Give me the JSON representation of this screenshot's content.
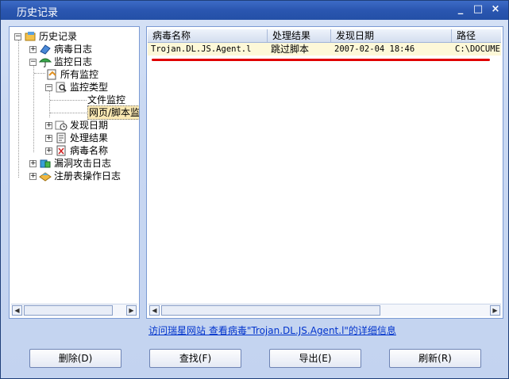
{
  "window": {
    "title": "历史记录",
    "controls": [
      "_",
      "□",
      "×"
    ]
  },
  "tree": {
    "root": "历史记录",
    "items": [
      {
        "label": "病毒日志",
        "expander": "+"
      },
      {
        "label": "监控日志",
        "expander": "−"
      },
      {
        "label": "所有监控"
      },
      {
        "label": "监控类型",
        "expander": "−"
      },
      {
        "label": "文件监控"
      },
      {
        "label": "网页/脚本监"
      },
      {
        "label": "发现日期",
        "expander": "+"
      },
      {
        "label": "处理结果",
        "expander": "+"
      },
      {
        "label": "病毒名称",
        "expander": "+"
      },
      {
        "label": "漏洞攻击日志",
        "expander": "+"
      },
      {
        "label": "注册表操作日志",
        "expander": "+"
      }
    ]
  },
  "list": {
    "columns": [
      "病毒名称",
      "处理结果",
      "发现日期",
      "路径"
    ],
    "rows": [
      {
        "name": "Trojan.DL.JS.Agent.l",
        "result": "跳过脚本",
        "date": "2007-02-04 18:46",
        "path": "C:\\DOCUME`"
      }
    ]
  },
  "link_text": "访问瑞星网站 查看病毒\"Trojan.DL.JS.Agent.l\"的详细信息",
  "buttons": {
    "delete": "删除(D)",
    "find": "查找(F)",
    "export": "导出(E)",
    "refresh": "刷新(R)"
  }
}
